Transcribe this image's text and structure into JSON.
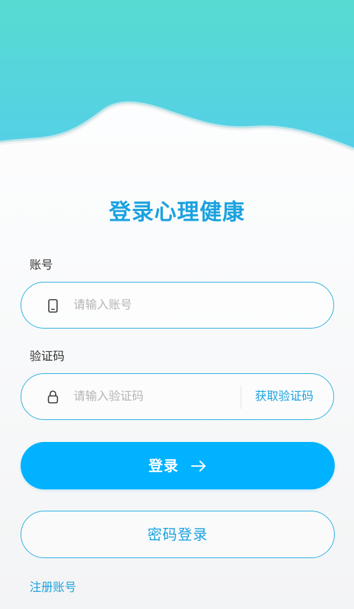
{
  "colors": {
    "accent": "#1aa2df",
    "primary_button": "#00b2ff",
    "header_top": "#56dbd2",
    "header_bottom": "#56d2e6"
  },
  "title": "登录心理健康",
  "account": {
    "label": "账号",
    "icon": "phone-icon",
    "placeholder": "请输入账号",
    "value": ""
  },
  "code": {
    "label": "验证码",
    "icon": "lock-icon",
    "placeholder": "请输入验证码",
    "value": "",
    "get_code_label": "获取验证码"
  },
  "login_button": {
    "label": "登录",
    "icon": "arrow-right-icon"
  },
  "password_login_button": {
    "label": "密码登录"
  },
  "register_link": "注册账号"
}
